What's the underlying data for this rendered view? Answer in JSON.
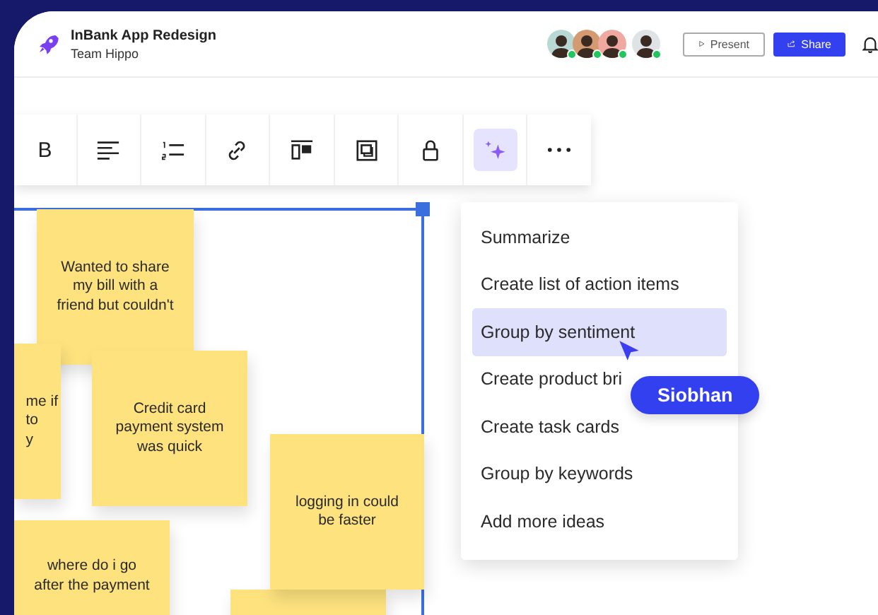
{
  "project": {
    "title": "InBank App Redesign",
    "team": "Team Hippo"
  },
  "collaborators": [
    {
      "online": true
    },
    {
      "online": true
    },
    {
      "online": true
    },
    {
      "online": true
    }
  ],
  "header_buttons": [
    {
      "kind": "present",
      "label": "Present"
    },
    {
      "kind": "share",
      "label": "Share"
    }
  ],
  "toolbar": [
    {
      "kind": "bold",
      "label": "B",
      "selected": false
    },
    {
      "kind": "align",
      "selected": false
    },
    {
      "kind": "list",
      "selected": false
    },
    {
      "kind": "link",
      "selected": false
    },
    {
      "kind": "layout",
      "selected": false
    },
    {
      "kind": "frame",
      "selected": false
    },
    {
      "kind": "lock",
      "selected": false
    },
    {
      "kind": "ai",
      "selected": true
    },
    {
      "kind": "more",
      "selected": false
    }
  ],
  "sticky_notes": [
    {
      "text": "Wanted to share my bill with a friend but couldn't"
    },
    {
      "text": "me if\nto\ny"
    },
    {
      "text": "Credit card payment system was quick"
    },
    {
      "text": "where do i go after the payment"
    },
    {
      "text": "logging in could be faster"
    }
  ],
  "ai_menu": {
    "items": [
      {
        "label": "Summarize",
        "selected": false
      },
      {
        "label": "Create list of action items",
        "selected": false
      },
      {
        "label": "Group by sentiment",
        "selected": true
      },
      {
        "label": "Create product bri",
        "selected": false
      },
      {
        "label": "Create task cards",
        "selected": false
      },
      {
        "label": "Group by  keywords",
        "selected": false
      },
      {
        "label": "Add more ideas",
        "selected": false
      }
    ]
  },
  "cursor": {
    "name": "Siobhan"
  }
}
